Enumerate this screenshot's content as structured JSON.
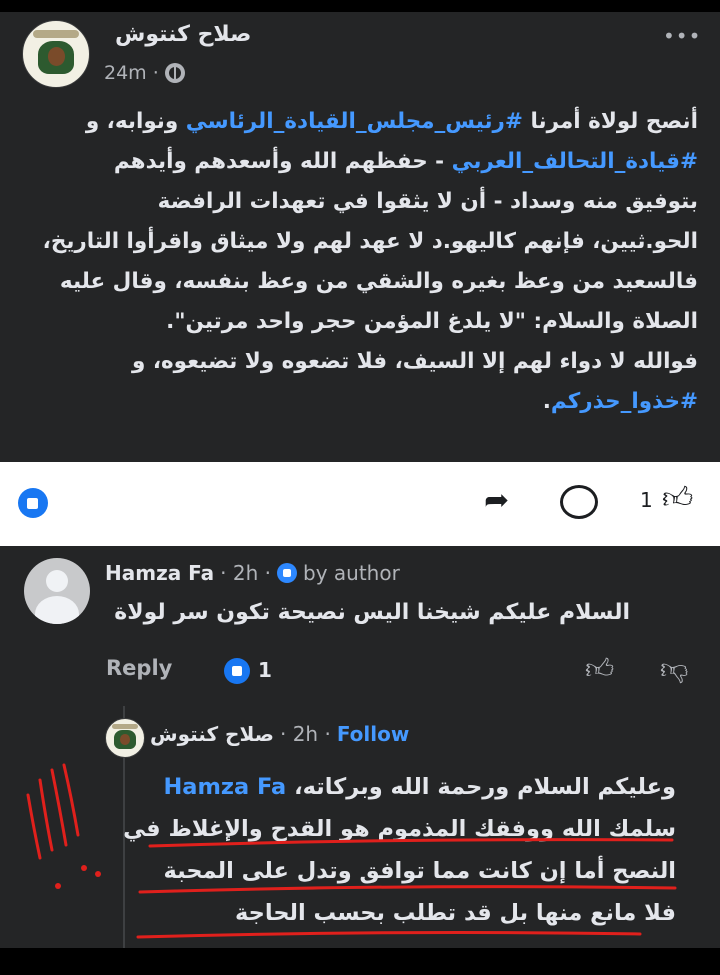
{
  "post": {
    "author": "صلاح كنتوش",
    "time": "24m",
    "more": "•••",
    "lines": [
      {
        "pre": "أنصح لولاة أمرنا ",
        "tag": "#رئيس_مجلس_القيادة_الرئاسي",
        "post": " ونوابه، و"
      },
      {
        "pre": "",
        "tag": "#قيادة_التحالف_العربي",
        "post": " - حفظهم الله وأسعدهم وأيدهم"
      },
      {
        "pre": "بتوفيق منه وسداد - أن لا يثقوا في تعهدات الرافضة",
        "tag": "",
        "post": ""
      },
      {
        "pre": "الحو.ثيين، فإنهم كاليهو.د لا عهد لهم ولا ميثاق واقرأوا التاريخ،",
        "tag": "",
        "post": ""
      },
      {
        "pre": "فالسعيد من وعظ بغيره والشقي من وعظ بنفسه، وقال عليه",
        "tag": "",
        "post": ""
      },
      {
        "pre": "الصلاة والسلام: \"لا يلدغ المؤمن حجر واحد مرتين\".",
        "tag": "",
        "post": ""
      },
      {
        "pre": "فوالله لا دواء لهم إلا السيف، فلا تضعوه ولا تضيعوه، و",
        "tag": "",
        "post": ""
      },
      {
        "pre": "",
        "tag": "#خذوا_حذركم",
        "post": "."
      }
    ]
  },
  "actions": {
    "like_count": "1"
  },
  "comment": {
    "name": "Hamza Fa",
    "time": "· 2h ·",
    "by_author": "by author",
    "text": "السلام عليكم شيخنا اليس نصيحة تكون سر لولاة",
    "reply_label": "Reply",
    "reaction_count": "1"
  },
  "reply": {
    "name": "صلاح كنتوش",
    "meta": "· 2h ·",
    "follow": "Follow",
    "mention": "Hamza Fa",
    "line1_rest": "وعليكم السلام ورحمة الله وبركاته،",
    "lines": [
      "سلمك الله ووفقك المذموم هو القدح والإغلاظ في",
      "النصح أما إن كانت مما توافق وتدل على المحبة",
      "فلا مانع منها بل قد تطلب بحسب الحاجة"
    ]
  },
  "colors": {
    "background": "#242526",
    "link": "#4599ff",
    "annotation": "#e0201c"
  }
}
